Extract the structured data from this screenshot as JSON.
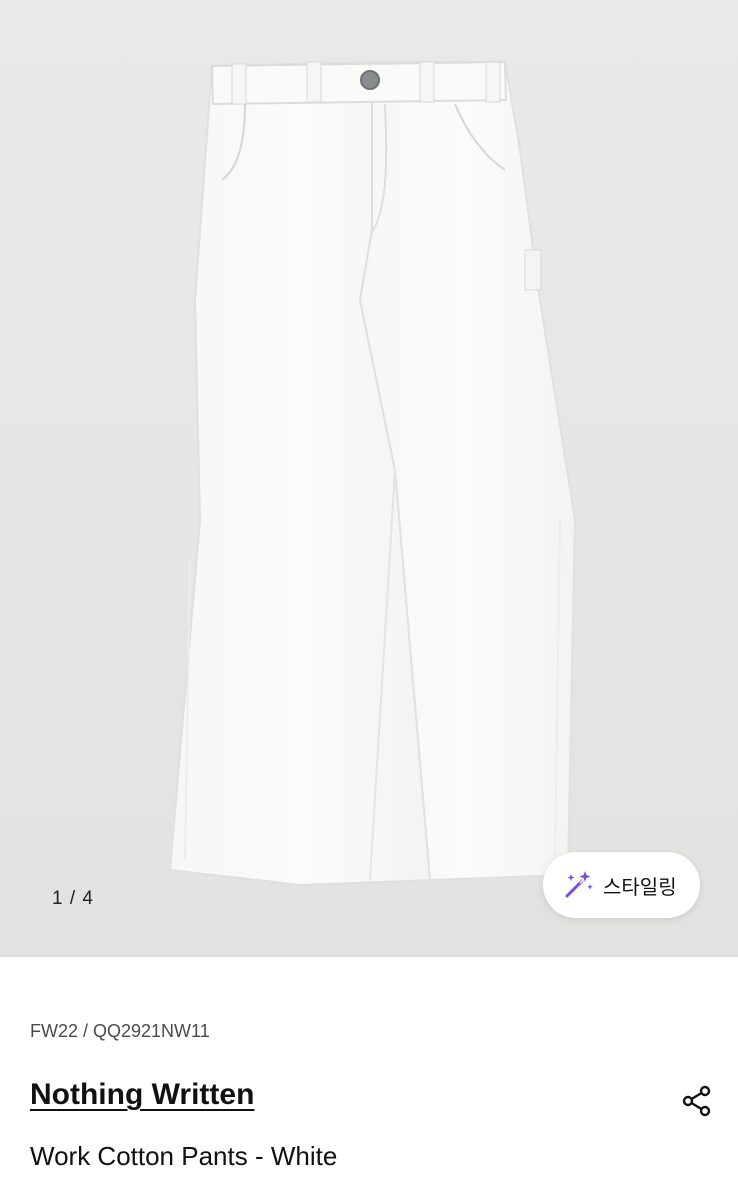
{
  "gallery": {
    "current": "1",
    "separator": " / ",
    "total": "4",
    "image_subject": "white-work-pants"
  },
  "styling_button": {
    "label": "스타일링",
    "icon": "magic-wand-icon",
    "icon_color": "#7a4fd6"
  },
  "product": {
    "code": "FW22 / QQ2921NW11",
    "brand": "Nothing Written",
    "name": "Work Cotton Pants - White"
  },
  "share": {
    "icon": "share-icon"
  }
}
